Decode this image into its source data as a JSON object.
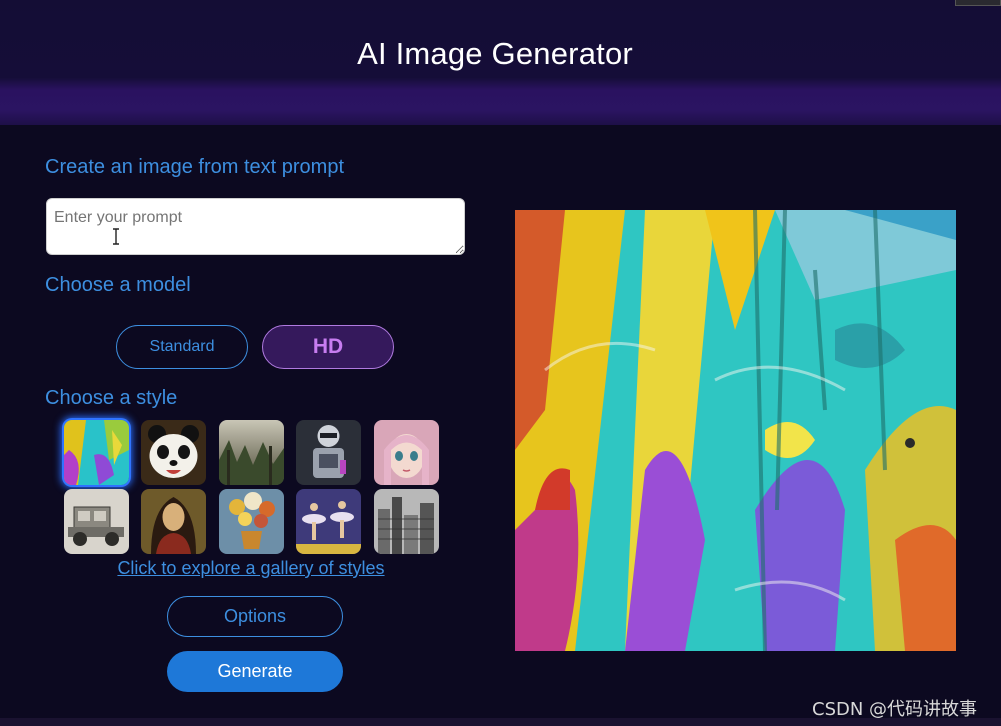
{
  "header": {
    "title": "AI Image Generator"
  },
  "prompt_section": {
    "heading": "Create an image from text prompt",
    "placeholder": "Enter your prompt",
    "value": ""
  },
  "model_section": {
    "heading": "Choose a model",
    "options": [
      "Standard",
      "HD"
    ],
    "selected": "HD"
  },
  "style_section": {
    "heading": "Choose a style",
    "styles": [
      "abstract-painting",
      "panda",
      "forest-landscape",
      "robot",
      "anime-girl",
      "vintage-car-sketch",
      "renaissance-portrait",
      "flower-vase",
      "ballet-dancers",
      "city-sketch"
    ],
    "selected": "abstract-painting",
    "gallery_link": "Click to explore a gallery of styles"
  },
  "buttons": {
    "options": "Options",
    "generate": "Generate"
  },
  "result": {
    "image": "abstract-painting-result"
  },
  "watermark": "CSDN @代码讲故事",
  "colors": {
    "accent": "#3d8fe0",
    "hd_purple": "#c77df0",
    "header_bg": "#140d35",
    "generate_bg": "#1e78d8"
  }
}
